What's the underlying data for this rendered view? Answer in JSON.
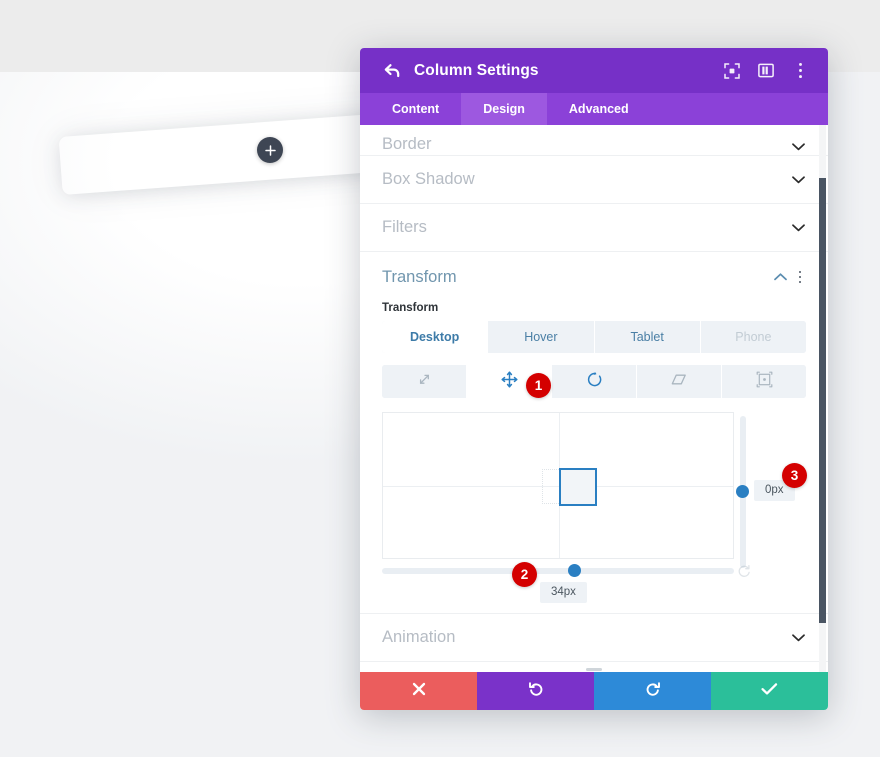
{
  "background": {
    "add_row_icon": "plus-icon",
    "row_placeholder": ""
  },
  "modal": {
    "title": "Column Settings",
    "back_icon": "back-arrow-icon",
    "header_icons": [
      {
        "name": "focus-icon"
      },
      {
        "name": "layout-panel-icon"
      },
      {
        "name": "kebab-menu-icon"
      }
    ],
    "tabs": [
      {
        "label": "Content",
        "active": false
      },
      {
        "label": "Design",
        "active": true
      },
      {
        "label": "Advanced",
        "active": false
      }
    ],
    "sections": [
      {
        "label": "Border",
        "open": false,
        "clipped": true
      },
      {
        "label": "Box Shadow",
        "open": false
      },
      {
        "label": "Filters",
        "open": false
      },
      {
        "label": "Transform",
        "open": true
      },
      {
        "label": "Animation",
        "open": false
      }
    ],
    "transform_panel": {
      "section_title": "Transform",
      "field_label": "Transform",
      "collapse_icon": "chevron-up-icon",
      "kebab_icon": "kebab-menu-icon",
      "device_tabs": [
        {
          "label": "Desktop",
          "state": "active"
        },
        {
          "label": "Hover",
          "state": "normal"
        },
        {
          "label": "Tablet",
          "state": "normal"
        },
        {
          "label": "Phone",
          "state": "disabled"
        }
      ],
      "modes": [
        {
          "name": "scale-icon",
          "state": "normal"
        },
        {
          "name": "translate-move-icon",
          "state": "active"
        },
        {
          "name": "rotate-icon",
          "state": "normal"
        },
        {
          "name": "skew-icon",
          "state": "normal"
        },
        {
          "name": "origin-icon",
          "state": "normal"
        }
      ],
      "horizontal_value": "34px",
      "vertical_value": "0px",
      "reset_icon": "reset-icon"
    },
    "action_bar": [
      {
        "name": "cancel-button",
        "icon": "close-x-icon",
        "color": "#eb5d5d"
      },
      {
        "name": "undo-button",
        "icon": "undo-arrow-icon",
        "color": "#7a32c9"
      },
      {
        "name": "redo-button",
        "icon": "redo-arrow-icon",
        "color": "#2d8ad8"
      },
      {
        "name": "save-button",
        "icon": "checkmark-icon",
        "color": "#2bbf9a"
      }
    ]
  },
  "callouts": [
    {
      "number": "1"
    },
    {
      "number": "2"
    },
    {
      "number": "3"
    }
  ],
  "colors": {
    "header_purple": "#7630c7",
    "tabbar_purple": "#8b41d8",
    "tab_active_purple": "#9d58e0",
    "accent_blue": "#2a7fc2",
    "badge_red": "#d40000"
  }
}
